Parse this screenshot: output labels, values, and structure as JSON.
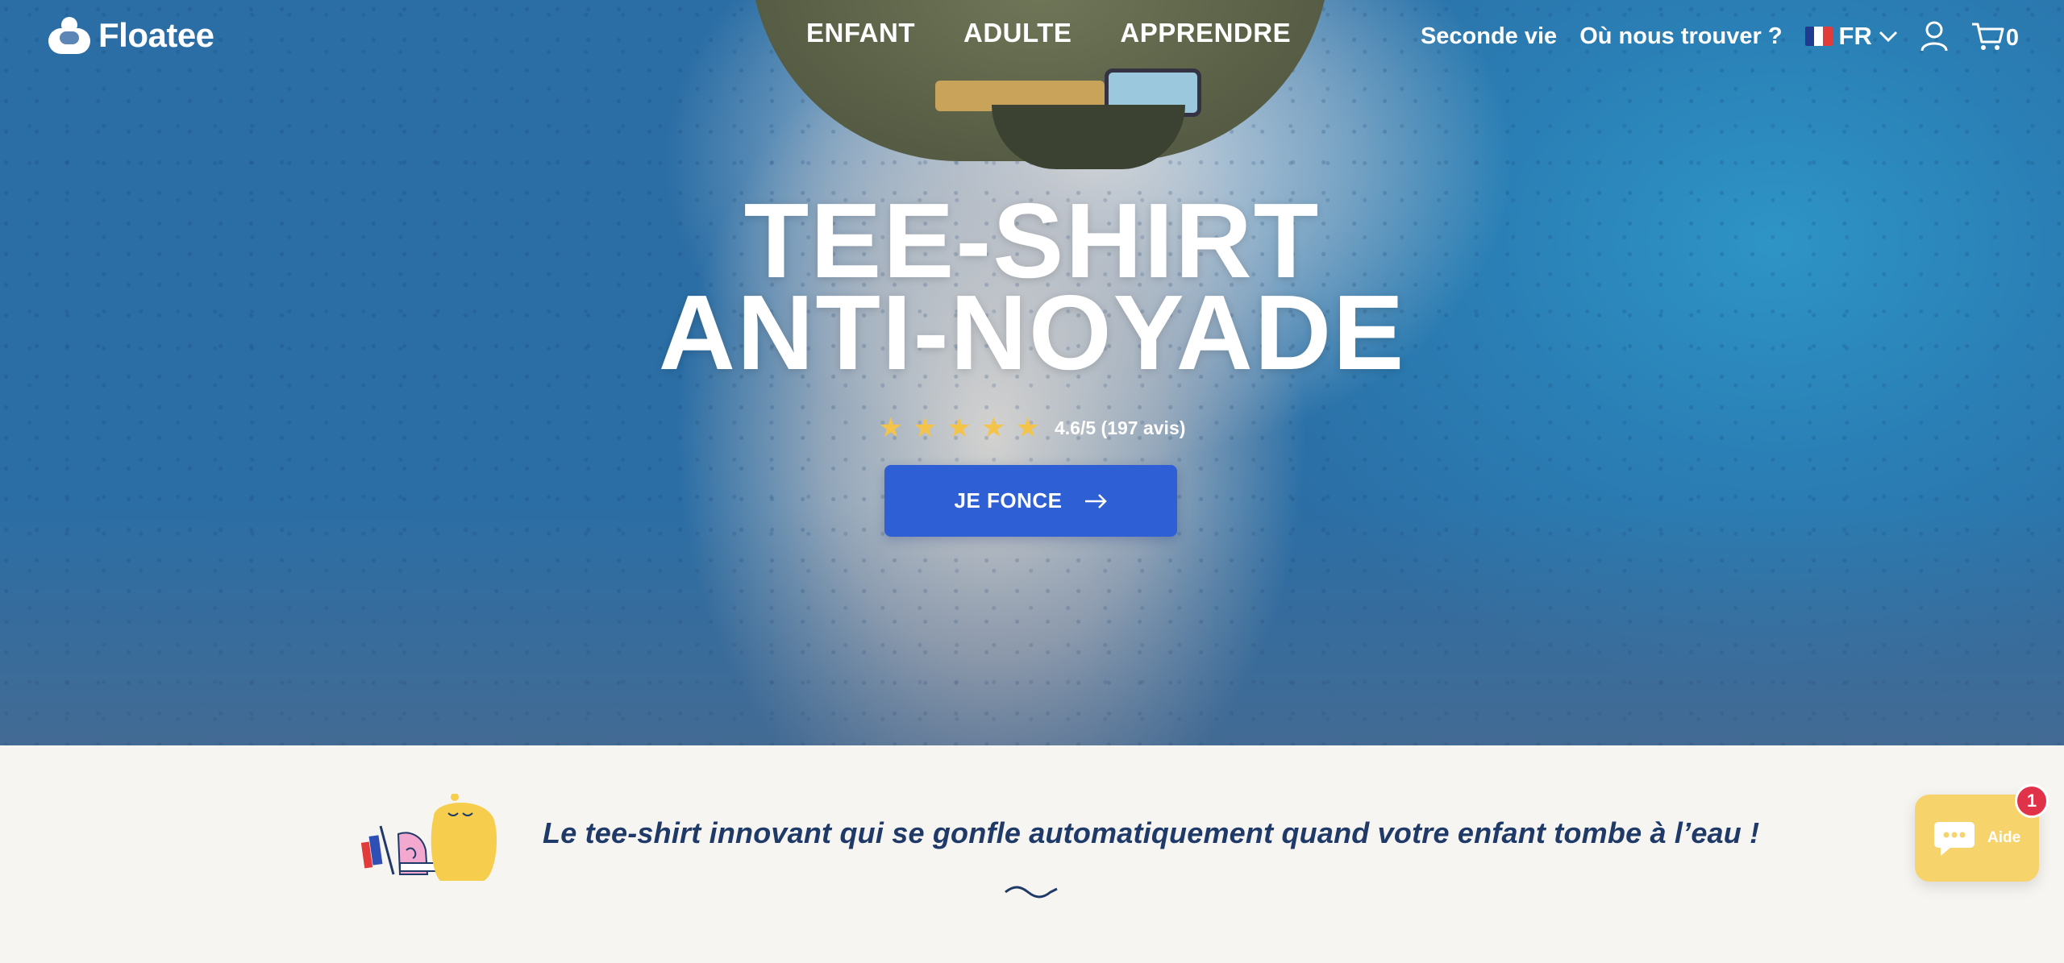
{
  "brand": {
    "name": "Floatee"
  },
  "nav": {
    "main": [
      "ENFANT",
      "ADULTE",
      "APPRENDRE"
    ],
    "secondary": [
      "Seconde vie",
      "Où nous trouver ?"
    ],
    "language": "FR",
    "cart_count": "0"
  },
  "hero": {
    "title_line1": "TEE-SHIRT",
    "title_line2": "ANTI-NOYADE",
    "rating_text": "4.6/5 (197 avis)",
    "rating_stars": 5,
    "cta_label": "JE FONCE"
  },
  "intro": {
    "tagline": "Le tee-shirt innovant qui se gonfle automatiquement quand votre enfant tombe à l’eau !"
  },
  "chat": {
    "label": "Aide",
    "badge": "1"
  },
  "colors": {
    "cta": "#2e5fd4",
    "star": "#f4c44a",
    "tagline": "#1f3a68",
    "chat": "#f6d36b",
    "badge": "#e0334a"
  },
  "icons": [
    "floatee-logo-icon",
    "flag-fr-icon",
    "chevron-down-icon",
    "account-icon",
    "cart-icon",
    "star-icon",
    "arrow-right-icon",
    "wave-icon",
    "chat-icon"
  ]
}
